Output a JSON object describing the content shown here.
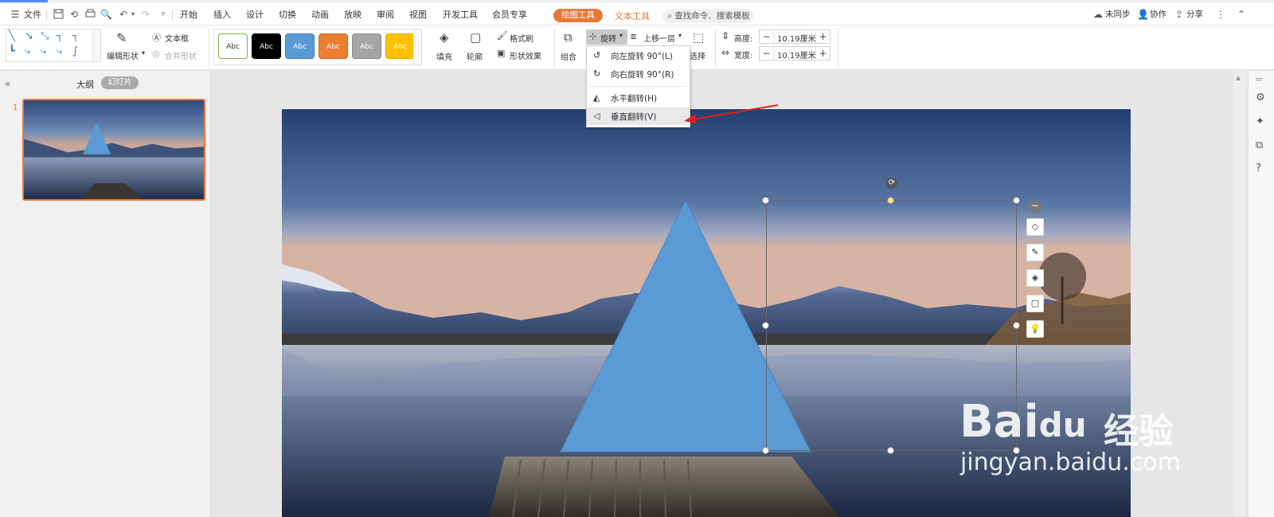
{
  "menubar": {
    "file": "文件",
    "tabs": [
      "开始",
      "插入",
      "设计",
      "切换",
      "动画",
      "放映",
      "审阅",
      "视图",
      "开发工具",
      "会员专享"
    ],
    "drawing_tools": "绘图工具",
    "text_tools": "文本工具",
    "search_placeholder": "查找命令、搜索模板",
    "sync": "未同步",
    "collab": "协作",
    "share": "分享"
  },
  "ribbon": {
    "edit_shape": "编辑形状",
    "text_box": "文本框",
    "merge_shape": "合并形状",
    "styles": [
      {
        "label": "Abc",
        "bg": "#ffffff",
        "fg": "#333333",
        "border": "#7cb342"
      },
      {
        "label": "Abc",
        "bg": "#000000",
        "fg": "#ffffff",
        "border": "#000000"
      },
      {
        "label": "Abc",
        "bg": "#5b9bd5",
        "fg": "#ffffff",
        "border": "#3d7cc0"
      },
      {
        "label": "Abc",
        "bg": "#ed7d31",
        "fg": "#ffffff",
        "border": "#d2691e"
      },
      {
        "label": "Abc",
        "bg": "#a5a5a5",
        "fg": "#ffffff",
        "border": "#8a8a8a"
      },
      {
        "label": "Abc",
        "bg": "#ffc000",
        "fg": "#ffffff",
        "border": "#e0a800"
      }
    ],
    "fill": "填充",
    "outline": "轮廓",
    "format_painter": "格式刷",
    "shape_effects": "形状效果",
    "group": "组合",
    "rotate": "旋转",
    "bring_forward": "上移一层",
    "select": "选择",
    "height_label": "高度:",
    "height_value": "10.19厘米",
    "width_label": "宽度:",
    "width_value": "10.19厘米"
  },
  "left_panel": {
    "outline_tab": "大纲",
    "slides_tab": "幻灯片",
    "slide_number": "1"
  },
  "rotate_menu": {
    "items": [
      {
        "label": "向左旋转 90°(L)",
        "icon": "rotate-left-icon"
      },
      {
        "label": "向右旋转 90°(R)",
        "icon": "rotate-right-icon"
      },
      {
        "label": "水平翻转(H)",
        "icon": "flip-horizontal-icon"
      },
      {
        "label": "垂直翻转(V)",
        "icon": "flip-vertical-icon"
      }
    ],
    "highlighted_index": 3
  },
  "watermark": {
    "brand": "Bai",
    "brand2": "du",
    "suffix": "经验",
    "url": "jingyan.baidu.com"
  },
  "colors": {
    "accent_orange": "#e8783a",
    "triangle_fill": "#5b9bd5",
    "annotation_arrow": "#e02020"
  }
}
